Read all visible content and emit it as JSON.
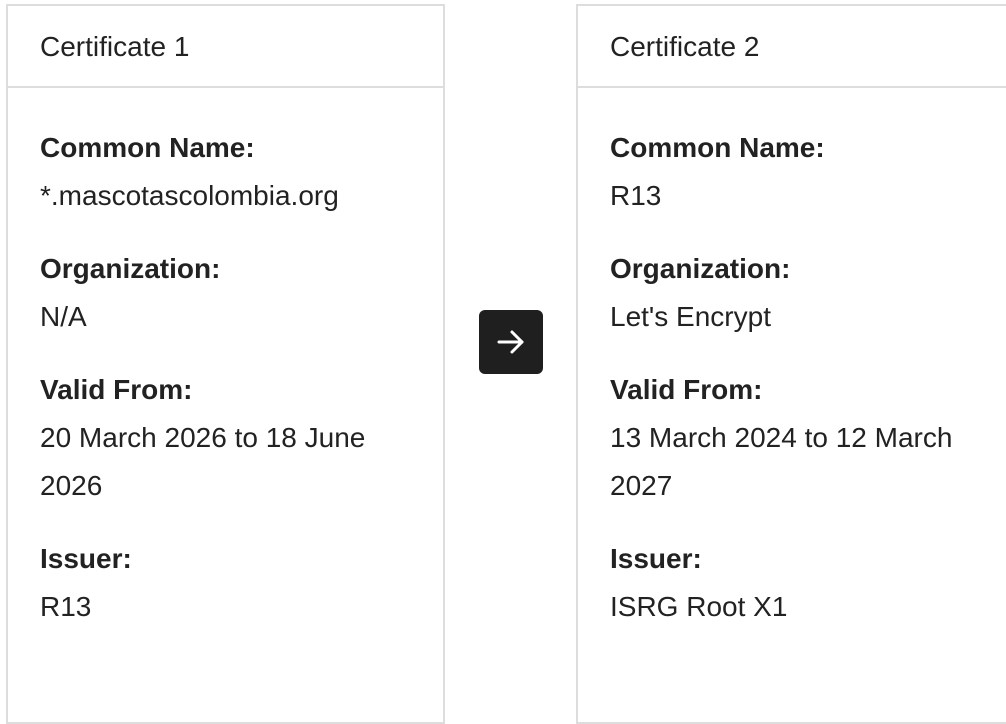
{
  "certificates": [
    {
      "title": "Certificate 1",
      "fields": [
        {
          "label": "Common Name:",
          "value": "*.mascotascolombia.org"
        },
        {
          "label": "Organization:",
          "value": "N/A"
        },
        {
          "label": "Valid From:",
          "value": "20 March 2026 to 18 June 2026"
        },
        {
          "label": "Issuer:",
          "value": "R13"
        }
      ]
    },
    {
      "title": "Certificate 2",
      "fields": [
        {
          "label": "Common Name:",
          "value": "R13"
        },
        {
          "label": "Organization:",
          "value": "Let's Encrypt"
        },
        {
          "label": "Valid From:",
          "value": "13 March 2024 to 12 March 2027"
        },
        {
          "label": "Issuer:",
          "value": "ISRG Root X1"
        }
      ]
    }
  ],
  "chain_arrow": {
    "icon": "arrow-right-icon"
  },
  "colors": {
    "border": "#dddddd",
    "arrow_bg": "#1f1f1f",
    "text": "#222222"
  }
}
